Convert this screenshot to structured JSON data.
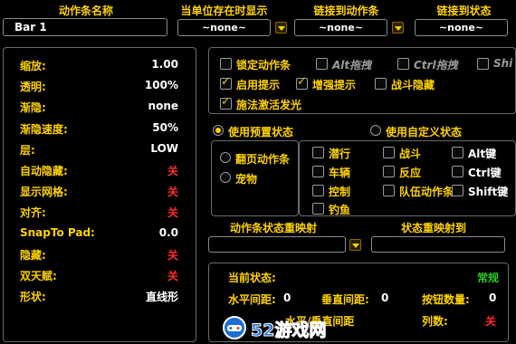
{
  "header": {
    "bar_name_label": "动作条名称",
    "show_when_unit_label": "当单位存在时显示",
    "link_bar_label": "链接到动作条",
    "link_state_label": "链接到状态",
    "bar_name_value": "Bar 1",
    "show_when_unit_value": "~none~",
    "link_bar_value": "~none~",
    "link_state_value": "~none~"
  },
  "left_settings": [
    {
      "label": "缩放:",
      "value": "1.00",
      "red": false
    },
    {
      "label": "透明:",
      "value": "100%",
      "red": false
    },
    {
      "label": "渐隐:",
      "value": "none",
      "red": false
    },
    {
      "label": "渐隐速度:",
      "value": "50%",
      "red": false
    },
    {
      "label": "层:",
      "value": "LOW",
      "red": false
    },
    {
      "label": "自动隐藏:",
      "value": "关",
      "red": true
    },
    {
      "label": "显示网格:",
      "value": "关",
      "red": true
    },
    {
      "label": "对齐:",
      "value": "关",
      "red": true
    },
    {
      "label": "SnapTo Pad:",
      "value": "0.0",
      "red": false
    },
    {
      "label": "隐藏:",
      "value": "关",
      "red": true
    },
    {
      "label": "双天赋:",
      "value": "关",
      "red": true
    },
    {
      "label": "形状:",
      "value": "直线形",
      "red": false
    }
  ],
  "options": {
    "lock_bar": "锁定动作条",
    "alt_drag": "Alt拖拽",
    "ctrl_drag": "Ctrl拖拽",
    "shift_drag": "Shi",
    "enable_tooltip": "启用提示",
    "enhanced_tooltip": "增强提示",
    "hide_in_combat": "战斗隐藏",
    "spell_glow": "施法激活发光"
  },
  "state": {
    "use_preset": "使用预置状态",
    "use_custom": "使用自定义状态",
    "page_bar": "翻页动作条",
    "pet": "宠物",
    "stealth": "潜行",
    "combat": "战斗",
    "alt_key": "Alt键",
    "vehicle": "车辆",
    "reaction": "反应",
    "ctrl_key": "Ctrl键",
    "control": "控制",
    "party_bar": "队伍动作条",
    "shift_key": "Shift键",
    "fishing": "钓鱼"
  },
  "remap": {
    "bar_state_remap": "动作条状态重映射",
    "state_remap_to": "状态重映射到"
  },
  "status": {
    "current_state_label": "当前状态:",
    "current_state_value": "常规",
    "h_spacing_label": "水平间距:",
    "h_spacing_value": "0",
    "v_spacing_label": "垂直间距:",
    "v_spacing_value": "0",
    "button_count_label": "按钮数量:",
    "button_count_value": "0",
    "hv_spacing_label": "水平/垂直间距",
    "columns_label": "列数:",
    "columns_value": "关"
  },
  "watermark": {
    "text": "52游戏网"
  }
}
